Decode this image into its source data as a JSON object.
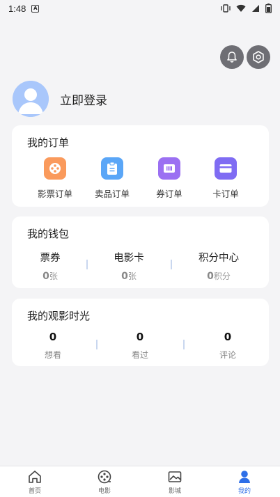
{
  "status": {
    "time": "1:48",
    "notif_letter": "A"
  },
  "profile": {
    "login_text": "立即登录"
  },
  "orders": {
    "title": "我的订单",
    "items": [
      {
        "label": "影票订单",
        "icon": "film-reel-icon",
        "color": "#fa9a5c"
      },
      {
        "label": "卖品订单",
        "icon": "clipboard-icon",
        "color": "#5aa6f7"
      },
      {
        "label": "券订单",
        "icon": "ticket-icon",
        "color": "#9b70f2"
      },
      {
        "label": "卡订单",
        "icon": "card-icon",
        "color": "#7f6cf3"
      }
    ]
  },
  "wallet": {
    "title": "我的钱包",
    "items": [
      {
        "name": "票券",
        "value": "0",
        "unit": "张"
      },
      {
        "name": "电影卡",
        "value": "0",
        "unit": "张"
      },
      {
        "name": "积分中心",
        "value": "0",
        "unit": "积分"
      }
    ]
  },
  "movies": {
    "title": "我的观影时光",
    "items": [
      {
        "value": "0",
        "label": "想看"
      },
      {
        "value": "0",
        "label": "看过"
      },
      {
        "value": "0",
        "label": "评论"
      }
    ]
  },
  "tabs": [
    {
      "label": "首页",
      "icon": "home-icon"
    },
    {
      "label": "电影",
      "icon": "film-icon"
    },
    {
      "label": "影城",
      "icon": "cinema-icon"
    },
    {
      "label": "我的",
      "icon": "profile-icon",
      "active": true
    }
  ],
  "colors": {
    "accent": "#2e6fe8",
    "avatar_bg": "#a9c7fb"
  }
}
